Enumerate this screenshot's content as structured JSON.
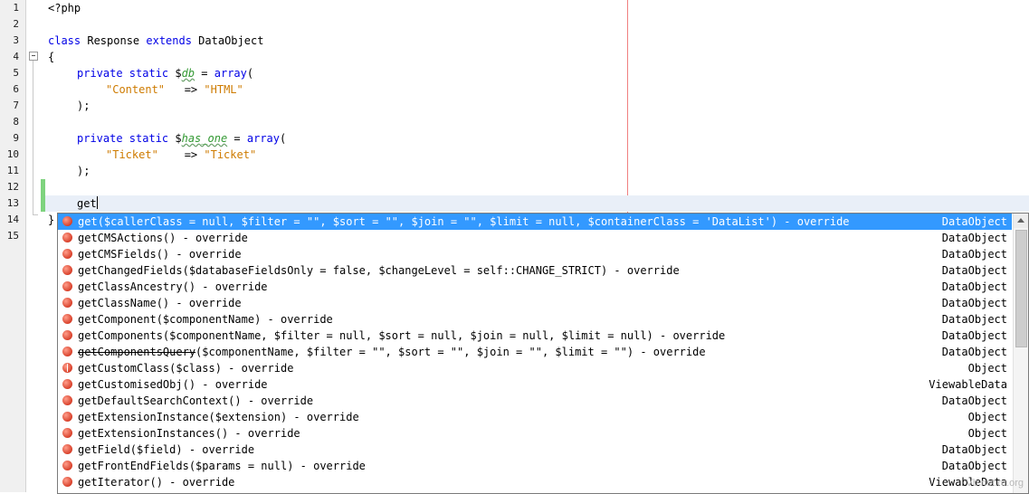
{
  "editor": {
    "line_numbers": [
      "1",
      "2",
      "3",
      "4",
      "5",
      "6",
      "7",
      "8",
      "9",
      "10",
      "11",
      "12",
      "13",
      "14",
      "15"
    ],
    "lines": {
      "l1": "<?php",
      "l3_kw1": "class",
      "l3_name": " Response ",
      "l3_kw2": "extends",
      "l3_parent": " DataObject",
      "l4": "{",
      "l5_kw": "private static ",
      "l5_dollar": "$",
      "l5_var": "db",
      "l5_eq": " = ",
      "l5_fn": "array",
      "l5_paren": "(",
      "l6_key": "\"Content\"",
      "l6_arrow": "   => ",
      "l6_val": "\"HTML\"",
      "l7": ");",
      "l9_kw": "private static ",
      "l9_dollar": "$",
      "l9_var": "has_one",
      "l9_eq": " = ",
      "l9_fn": "array",
      "l9_paren": "(",
      "l10_key": "\"Ticket\"",
      "l10_arrow": "    => ",
      "l10_val": "\"Ticket\"",
      "l11": ");",
      "l13": "get",
      "l14": "}"
    }
  },
  "completion": {
    "items": [
      {
        "name": "get",
        "params": "($callerClass = null, $filter = \"\", $sort = \"\", $join = \"\", $limit = null, $containerClass = 'DataList')",
        "suffix": " - override",
        "owner": "DataObject"
      },
      {
        "name": "getCMSActions",
        "params": "()",
        "suffix": " - override",
        "owner": "DataObject"
      },
      {
        "name": "getCMSFields",
        "params": "()",
        "suffix": " - override",
        "owner": "DataObject"
      },
      {
        "name": "getChangedFields",
        "params": "($databaseFieldsOnly = false, $changeLevel = self::CHANGE_STRICT)",
        "suffix": " - override",
        "owner": "DataObject"
      },
      {
        "name": "getClassAncestry",
        "params": "()",
        "suffix": " - override",
        "owner": "DataObject"
      },
      {
        "name": "getClassName",
        "params": "()",
        "suffix": " - override",
        "owner": "DataObject"
      },
      {
        "name": "getComponent",
        "params": "($componentName)",
        "suffix": " - override",
        "owner": "DataObject"
      },
      {
        "name": "getComponents",
        "params": "($componentName, $filter = null, $sort = null, $join = null, $limit = null)",
        "suffix": " - override",
        "owner": "DataObject"
      },
      {
        "name": "getComponentsQuery",
        "params": "($componentName, $filter = \"\", $sort = \"\", $join = \"\", $limit = \"\")",
        "suffix": " - override",
        "owner": "DataObject"
      },
      {
        "name": "getCustomClass",
        "params": "($class)",
        "suffix": " - override",
        "owner": "Object"
      },
      {
        "name": "getCustomisedObj",
        "params": "()",
        "suffix": " - override",
        "owner": "ViewableData"
      },
      {
        "name": "getDefaultSearchContext",
        "params": "()",
        "suffix": " - override",
        "owner": "DataObject"
      },
      {
        "name": "getExtensionInstance",
        "params": "($extension)",
        "suffix": " - override",
        "owner": "Object"
      },
      {
        "name": "getExtensionInstances",
        "params": "()",
        "suffix": " - override",
        "owner": "Object"
      },
      {
        "name": "getField",
        "params": "($field)",
        "suffix": " - override",
        "owner": "DataObject"
      },
      {
        "name": "getFrontEndFields",
        "params": "($params = null)",
        "suffix": " - override",
        "owner": "DataObject"
      },
      {
        "name": "getIterator",
        "params": "()",
        "suffix": " - override",
        "owner": "ViewableData"
      }
    ]
  },
  "watermark": "Vb.net.ru.org",
  "colors": {
    "keyword": "#0000e6",
    "string": "#ce7b00",
    "variable": "#339933",
    "selection": "#3399ff",
    "margin_line": "#f08080",
    "modified_marker": "#7ed37e",
    "method_icon": "#d8402a"
  },
  "icons": {
    "method": "method-icon",
    "fold": "fold-collapse-icon"
  }
}
